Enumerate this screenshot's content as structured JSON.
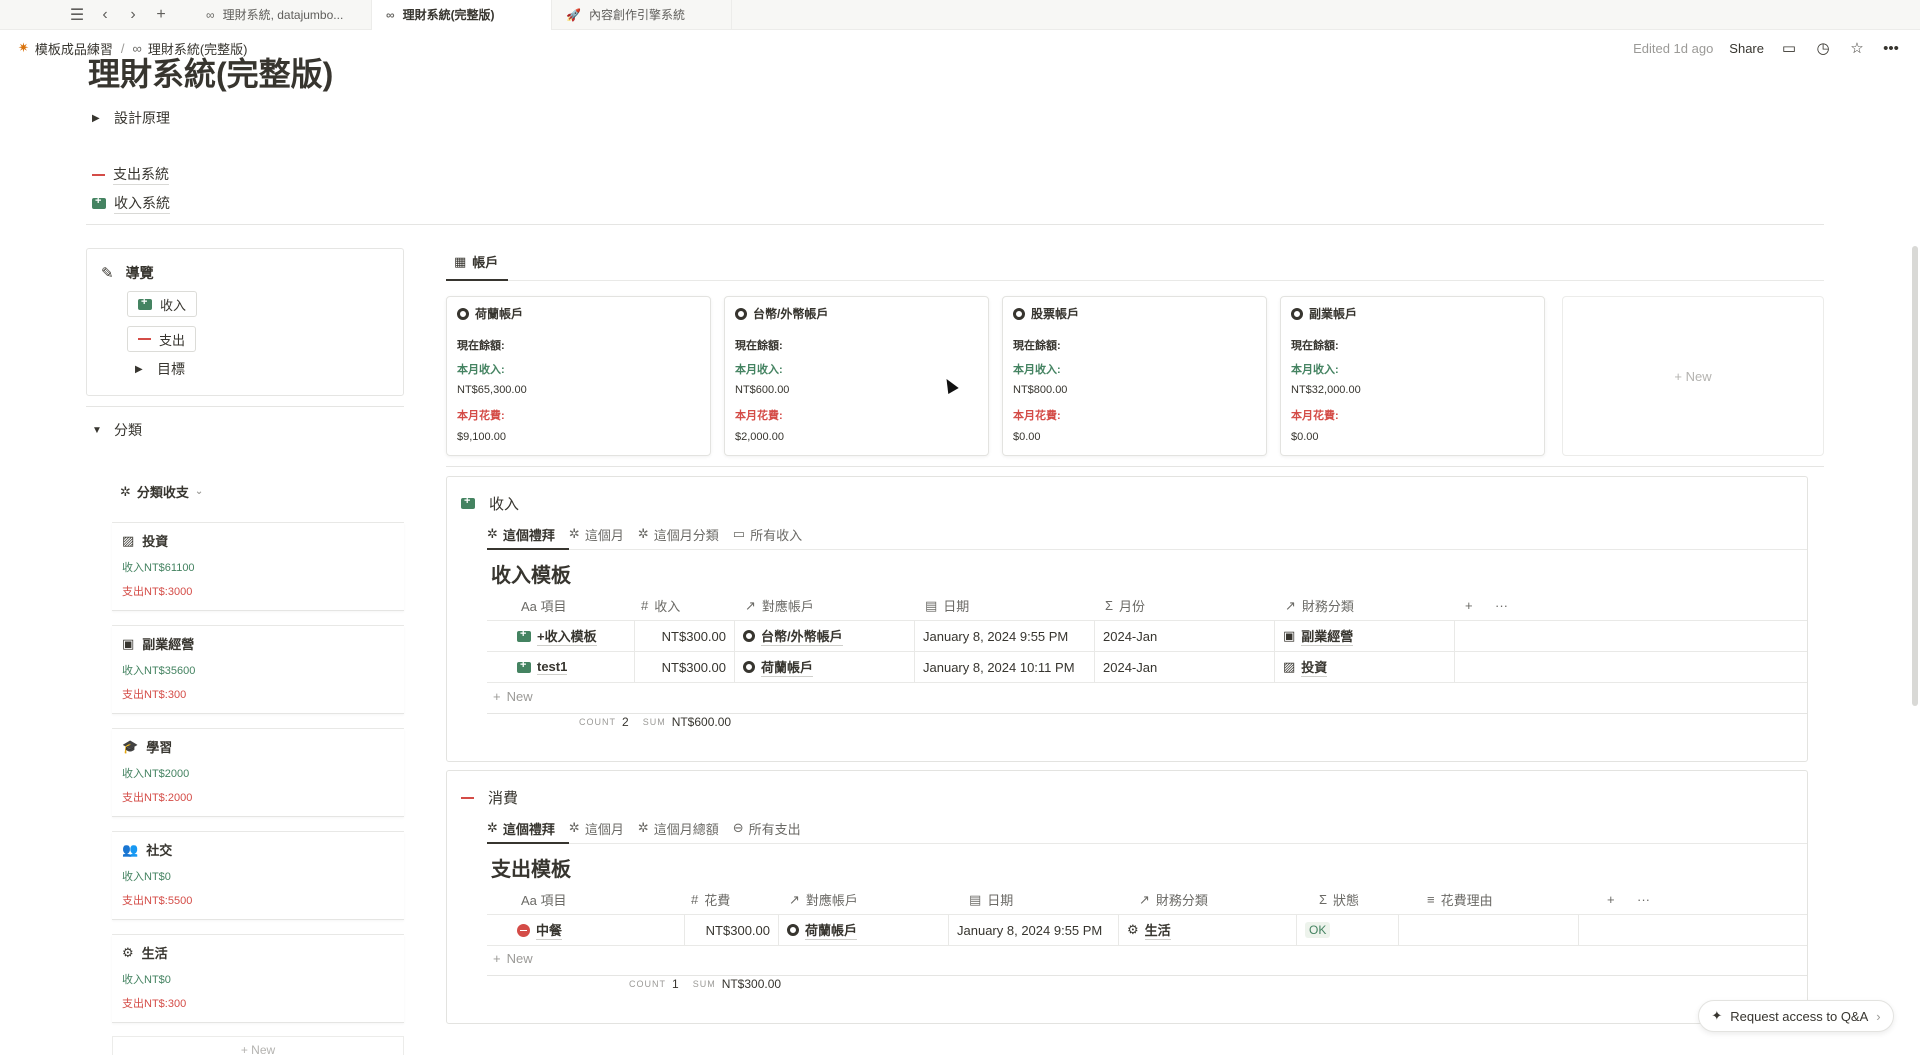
{
  "tabs": [
    {
      "label": "理財系統, datajumbo...",
      "icon": "link-icon"
    },
    {
      "label": "理財系統(完整版)",
      "icon": "link-icon",
      "active": true
    },
    {
      "label": "內容創作引擎系統",
      "icon": "rocket-icon"
    }
  ],
  "breadcrumb": {
    "parent": "模板成品練習",
    "current": "理財系統(完整版)"
  },
  "topbar": {
    "edited": "Edited 1d ago",
    "share": "Share"
  },
  "page": {
    "title": "理財系統(完整版)",
    "toggle_design": "設計原理",
    "link_expense": "支出系統",
    "link_income": "收入系統"
  },
  "nav": {
    "title": "導覽",
    "income": "收入",
    "expense": "支出",
    "goal": "目標"
  },
  "categories": {
    "toggle": "分類",
    "view": "分類收支",
    "items": [
      {
        "name": "投資",
        "in": "收入NT$61100",
        "out": "支出NT$:3000",
        "icon": "chart-icon"
      },
      {
        "name": "副業經營",
        "in": "收入NT$35600",
        "out": "支出NT$:300",
        "icon": "briefcase-icon"
      },
      {
        "name": "學習",
        "in": "收入NT$2000",
        "out": "支出NT$:2000",
        "icon": "graduation-icon"
      },
      {
        "name": "社交",
        "in": "收入NT$0",
        "out": "支出NT$:5500",
        "icon": "people-icon"
      },
      {
        "name": "生活",
        "in": "收入NT$0",
        "out": "支出NT$:300",
        "icon": "gear-icon"
      }
    ],
    "new_label": "New"
  },
  "accounts": {
    "tab": "帳戶",
    "balance_label": "現在餘額:",
    "income_label": "本月收入:",
    "spend_label": "本月花費:",
    "cards": [
      {
        "name": "荷蘭帳戶",
        "income": "NT$65,300.00",
        "spend": "$9,100.00"
      },
      {
        "name": "台幣/外幣帳戶",
        "income": "NT$600.00",
        "spend": "$2,000.00"
      },
      {
        "name": "股票帳戶",
        "income": "NT$800.00",
        "spend": "$0.00"
      },
      {
        "name": "副業帳戶",
        "income": "NT$32,000.00",
        "spend": "$0.00"
      }
    ],
    "new_label": "New"
  },
  "income_db": {
    "title": "收入",
    "views": [
      "這個禮拜",
      "這個月",
      "這個月分類",
      "所有收入"
    ],
    "name": "收入模板",
    "columns": [
      "Aa 項目",
      "收入",
      "對應帳戶",
      "日期",
      "月份",
      "財務分類"
    ],
    "rows": [
      {
        "item": "+收入模板",
        "amount": "NT$300.00",
        "account": "台幣/外幣帳戶",
        "date": "January 8, 2024 9:55 PM",
        "month": "2024-Jan",
        "category": "副業經營"
      },
      {
        "item": "test1",
        "amount": "NT$300.00",
        "account": "荷蘭帳戶",
        "date": "January 8, 2024 10:11 PM",
        "month": "2024-Jan",
        "category": "投資"
      }
    ],
    "new_label": "New",
    "count_label": "COUNT",
    "count": "2",
    "sum_label": "SUM",
    "sum": "NT$600.00"
  },
  "expense_db": {
    "title": "消費",
    "views": [
      "這個禮拜",
      "這個月",
      "這個月總額",
      "所有支出"
    ],
    "name": "支出模板",
    "columns": [
      "Aa 項目",
      "花費",
      "對應帳戶",
      "日期",
      "財務分類",
      "狀態",
      "花費理由"
    ],
    "rows": [
      {
        "item": "中餐",
        "amount": "NT$300.00",
        "account": "荷蘭帳戶",
        "date": "January 8, 2024 9:55 PM",
        "category": "生活",
        "status": "OK",
        "reason": ""
      }
    ],
    "new_label": "New",
    "count_label": "COUNT",
    "count": "1",
    "sum_label": "SUM",
    "sum": "NT$300.00"
  },
  "qa": {
    "label": "Request access to Q&A"
  },
  "colors": {
    "green": "#448361",
    "red": "#d44c47",
    "text": "#37352f"
  }
}
